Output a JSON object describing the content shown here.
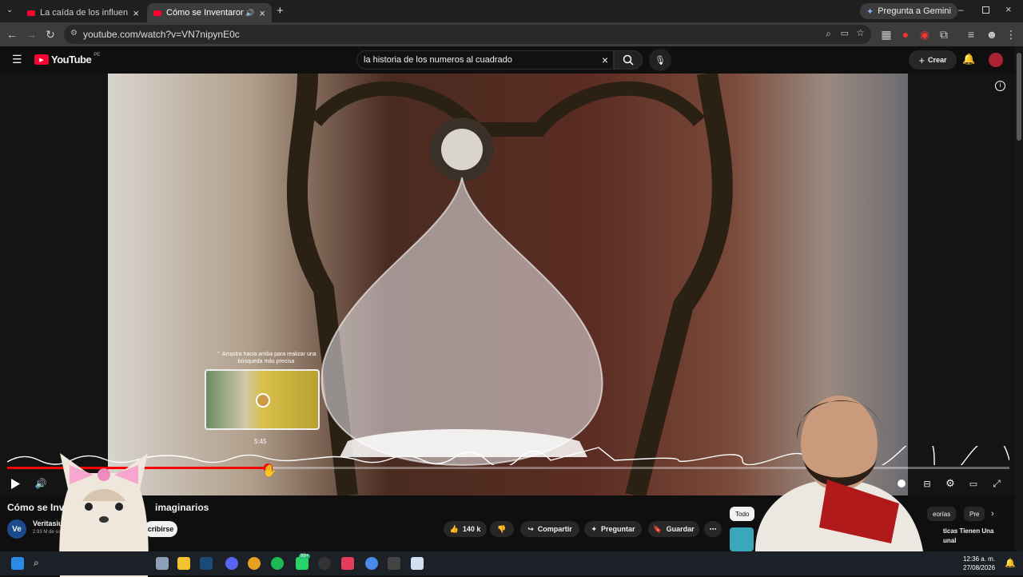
{
  "browser": {
    "tabs": [
      {
        "label": "La caída de los influencers. - Yo",
        "active": false
      },
      {
        "label": "Cómo se Inventaron los Nú",
        "active": true
      }
    ],
    "url": "youtube.com/watch?v=VN7nipynE0c",
    "gemini_label": "Pregunta a Gemini"
  },
  "youtube": {
    "logo_text": "YouTube",
    "logo_region": "PE",
    "search_value": "la historia de los numeros al cuadrado",
    "create_label": "Crear"
  },
  "player": {
    "drag_hint": "⌃ Arrastra hacia arriba para realizar una búsqueda más precisa",
    "preview_time": "5:45",
    "progress_fraction": 0.26
  },
  "video": {
    "title": "Cómo se Inven... imaginarios",
    "title_visible_left": "Cómo se Inven",
    "title_visible_right": "imaginarios",
    "channel": "Veritasium e",
    "channel_avatar": "Ve",
    "subscribers": "2.93 M de susc",
    "subscribe_label": "cribirse",
    "likes": "140 k",
    "share_label": "Compartir",
    "ask_label": "Preguntar",
    "save_label": "Guardar"
  },
  "chips": {
    "todo": "Todo",
    "teorias": "eorías",
    "pre": "Pre"
  },
  "sidebar_partial": {
    "line1": "ticas Tienen Una",
    "line2": "unal"
  },
  "taskbar": {
    "time": "12:36 a. m.",
    "date": "27/08/2026",
    "badge": "99+"
  }
}
